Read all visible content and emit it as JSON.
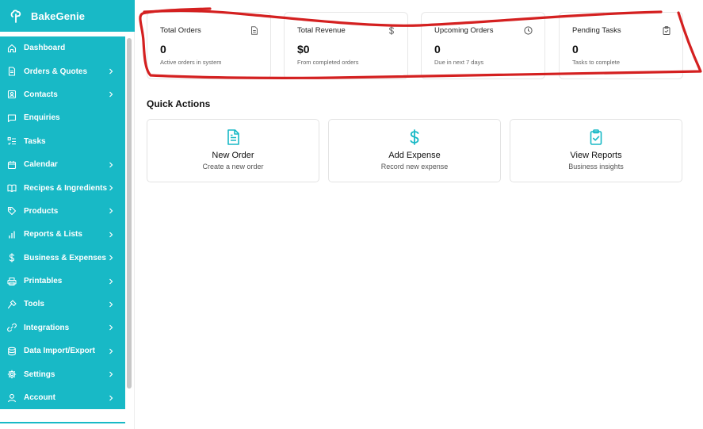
{
  "brand": {
    "name": "BakeGenie"
  },
  "colors": {
    "accent": "#18b9c6",
    "annotation": "#d42020"
  },
  "sidebar": {
    "items": [
      {
        "label": "Dashboard",
        "icon": "home-icon",
        "chevron": false
      },
      {
        "label": "Orders & Quotes",
        "icon": "document-icon",
        "chevron": true
      },
      {
        "label": "Contacts",
        "icon": "contact-card-icon",
        "chevron": true
      },
      {
        "label": "Enquiries",
        "icon": "chat-bubble-icon",
        "chevron": false
      },
      {
        "label": "Tasks",
        "icon": "checklist-icon",
        "chevron": false
      },
      {
        "label": "Calendar",
        "icon": "calendar-icon",
        "chevron": true
      },
      {
        "label": "Recipes & Ingredients",
        "icon": "book-icon",
        "chevron": true
      },
      {
        "label": "Products",
        "icon": "tag-icon",
        "chevron": true
      },
      {
        "label": "Reports & Lists",
        "icon": "bar-chart-icon",
        "chevron": true
      },
      {
        "label": "Business & Expenses",
        "icon": "dollar-icon",
        "chevron": true
      },
      {
        "label": "Printables",
        "icon": "printer-icon",
        "chevron": true
      },
      {
        "label": "Tools",
        "icon": "hammer-icon",
        "chevron": true
      },
      {
        "label": "Integrations",
        "icon": "link-icon",
        "chevron": true
      },
      {
        "label": "Data Import/Export",
        "icon": "database-icon",
        "chevron": true
      },
      {
        "label": "Settings",
        "icon": "gear-icon",
        "chevron": true
      },
      {
        "label": "Account",
        "icon": "user-icon",
        "chevron": true
      }
    ]
  },
  "stats": [
    {
      "title": "Total Orders",
      "value": "0",
      "sub": "Active orders in system",
      "icon": "document-icon"
    },
    {
      "title": "Total Revenue",
      "value": "$0",
      "sub": "From completed orders",
      "icon": "dollar-icon"
    },
    {
      "title": "Upcoming Orders",
      "value": "0",
      "sub": "Due in next 7 days",
      "icon": "clock-icon"
    },
    {
      "title": "Pending Tasks",
      "value": "0",
      "sub": "Tasks to complete",
      "icon": "clipboard-check-icon"
    }
  ],
  "quick_actions": {
    "title": "Quick Actions",
    "items": [
      {
        "title": "New Order",
        "sub": "Create a new order",
        "icon": "document-icon"
      },
      {
        "title": "Add Expense",
        "sub": "Record new expense",
        "icon": "dollar-icon"
      },
      {
        "title": "View Reports",
        "sub": "Business insights",
        "icon": "clipboard-check-icon"
      }
    ]
  }
}
